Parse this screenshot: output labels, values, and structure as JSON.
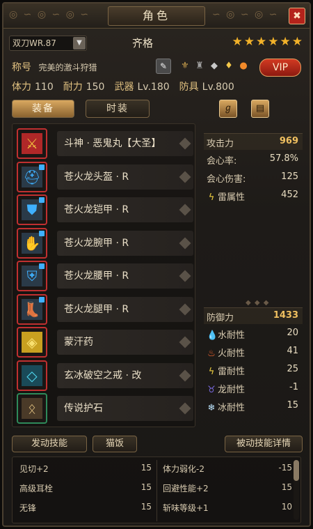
{
  "window": {
    "title": "角色",
    "close_icon": "close-icon"
  },
  "header": {
    "weapon_select": "双刀WR.87",
    "character_name": "齐格",
    "stars": 6,
    "title_label": "称号",
    "title_value": "完美的激斗狩猎",
    "vip_label": "VIP",
    "badges": [
      "rank-badge-icon",
      "statue-icon",
      "gem-icon",
      "diamond-icon",
      "orb-icon"
    ]
  },
  "stats": [
    {
      "label": "体力",
      "value": "110"
    },
    {
      "label": "耐力",
      "value": "150"
    },
    {
      "label": "武器",
      "value": "Lv.180"
    },
    {
      "label": "防具",
      "value": "Lv.800"
    }
  ],
  "tabs": [
    {
      "label": "装备",
      "active": true
    },
    {
      "label": "时装",
      "active": false
    }
  ],
  "equipment": [
    {
      "name": "斗神 · 恶鬼丸【大圣】",
      "icon": "dual-blades-icon",
      "rarity": "red"
    },
    {
      "name": "苍火龙头盔 · R",
      "icon": "helmet-icon",
      "rarity": "red"
    },
    {
      "name": "苍火龙铠甲 · R",
      "icon": "chest-armor-icon",
      "rarity": "red"
    },
    {
      "name": "苍火龙腕甲 · R",
      "icon": "gauntlet-icon",
      "rarity": "red"
    },
    {
      "name": "苍火龙腰甲 · R",
      "icon": "waist-armor-icon",
      "rarity": "red"
    },
    {
      "name": "苍火龙腿甲 · R",
      "icon": "leg-armor-icon",
      "rarity": "red"
    },
    {
      "name": "蒙汗药",
      "icon": "potion-icon",
      "rarity": "red"
    },
    {
      "name": "玄冰破空之戒 · 改",
      "icon": "ring-icon",
      "rarity": "red"
    },
    {
      "name": "传说护石",
      "icon": "talisman-icon",
      "rarity": "green"
    }
  ],
  "attack_stats": [
    {
      "label": "攻击力",
      "value": "969",
      "highlight": true
    },
    {
      "label": "会心率:",
      "value": "57.8%"
    },
    {
      "label": "会心伤害:",
      "value": "125"
    },
    {
      "label": "雷属性",
      "value": "452",
      "icon": "thunder-icon"
    }
  ],
  "defense_stats": [
    {
      "label": "防御力",
      "value": "1433",
      "highlight": true
    },
    {
      "label": "水耐性",
      "value": "20",
      "icon": "water-icon"
    },
    {
      "label": "火耐性",
      "value": "41",
      "icon": "fire-icon"
    },
    {
      "label": "雷耐性",
      "value": "25",
      "icon": "thunder-icon"
    },
    {
      "label": "龙耐性",
      "value": "-1",
      "icon": "dragon-icon"
    },
    {
      "label": "冰耐性",
      "value": "15",
      "icon": "ice-icon"
    }
  ],
  "skill_tabs": [
    {
      "label": "发动技能"
    },
    {
      "label": "猫饭"
    },
    {
      "label": "被动技能详情"
    }
  ],
  "skills": [
    {
      "name": "见切+2",
      "value": "15"
    },
    {
      "name": "体力弱化-2",
      "value": "-15"
    },
    {
      "name": "高级耳栓",
      "value": "15"
    },
    {
      "name": "回避性能+2",
      "value": "15"
    },
    {
      "name": "无锋",
      "value": "15"
    },
    {
      "name": "斩味等级+1",
      "value": "10"
    }
  ],
  "colors": {
    "accent_gold": "#f0c060",
    "close_red": "#b4231b",
    "vip_red": "#d23a22",
    "rarity_red": "#c03030",
    "rarity_green": "#2e8a5a"
  }
}
